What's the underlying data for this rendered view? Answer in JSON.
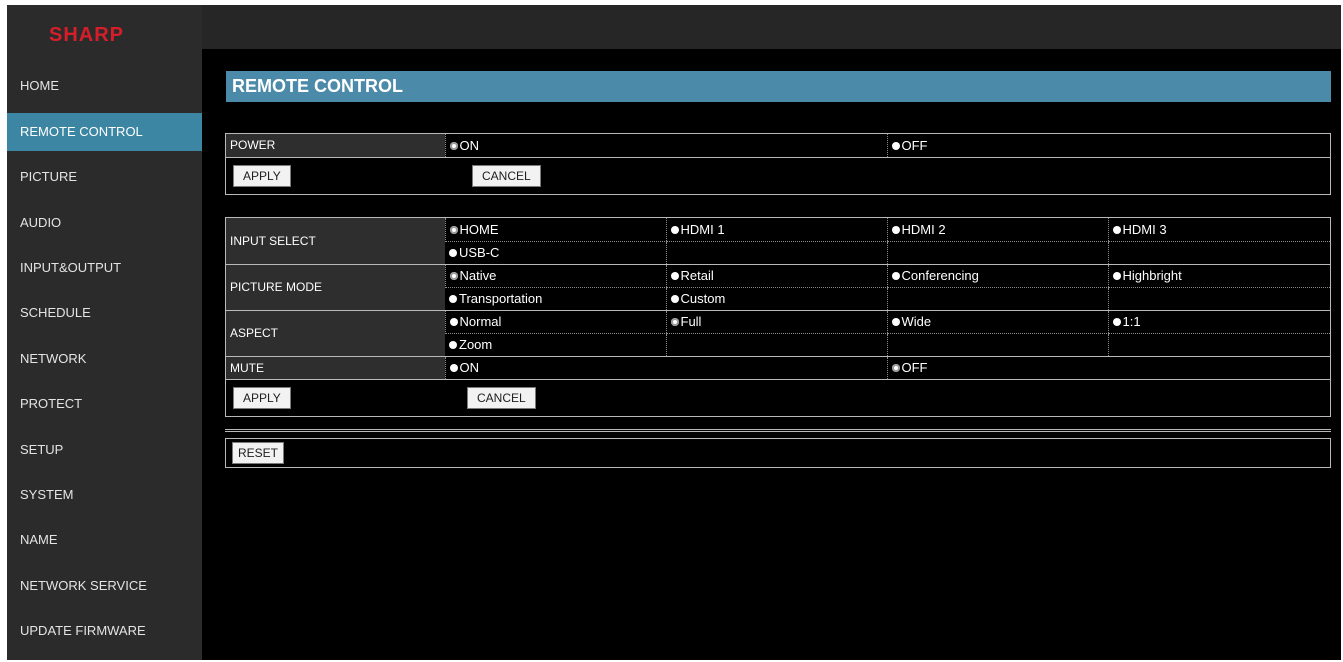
{
  "brand": {
    "logo_text": "SHARP",
    "logo_color": "#d61e2b"
  },
  "colors": {
    "accent": "#3c86a4",
    "title_bar": "#4b8aa8"
  },
  "sidebar": {
    "items": [
      {
        "id": "home",
        "label": "HOME"
      },
      {
        "id": "remote-control",
        "label": "REMOTE CONTROL",
        "active": true
      },
      {
        "id": "picture",
        "label": "PICTURE"
      },
      {
        "id": "audio",
        "label": "AUDIO"
      },
      {
        "id": "input-output",
        "label": "INPUT&OUTPUT"
      },
      {
        "id": "schedule",
        "label": "SCHEDULE"
      },
      {
        "id": "network",
        "label": "NETWORK"
      },
      {
        "id": "protect",
        "label": "PROTECT"
      },
      {
        "id": "setup",
        "label": "SETUP"
      },
      {
        "id": "system",
        "label": "SYSTEM"
      },
      {
        "id": "name",
        "label": "NAME"
      },
      {
        "id": "network-service",
        "label": "NETWORK SERVICE"
      },
      {
        "id": "update-firmware",
        "label": "UPDATE FIRMWARE"
      }
    ]
  },
  "page": {
    "title": "REMOTE CONTROL"
  },
  "power": {
    "label": "POWER",
    "options": [
      "ON",
      "OFF"
    ],
    "selected": "ON",
    "apply_label": "APPLY",
    "cancel_label": "CANCEL"
  },
  "settings": {
    "input_select": {
      "label": "INPUT SELECT",
      "options": [
        "HOME",
        "HDMI 1",
        "HDMI 2",
        "HDMI 3",
        "USB-C"
      ],
      "selected": "HOME"
    },
    "picture_mode": {
      "label": "PICTURE MODE",
      "options": [
        "Native",
        "Retail",
        "Conferencing",
        "Highbright",
        "Transportation",
        "Custom"
      ],
      "selected": "Native"
    },
    "aspect": {
      "label": "ASPECT",
      "options": [
        "Normal",
        "Full",
        "Wide",
        "1:1",
        "Zoom"
      ],
      "selected": "Full"
    },
    "mute": {
      "label": "MUTE",
      "options": [
        "ON",
        "OFF"
      ],
      "selected": "OFF"
    },
    "apply_label": "APPLY",
    "cancel_label": "CANCEL"
  },
  "reset": {
    "label": "RESET"
  }
}
